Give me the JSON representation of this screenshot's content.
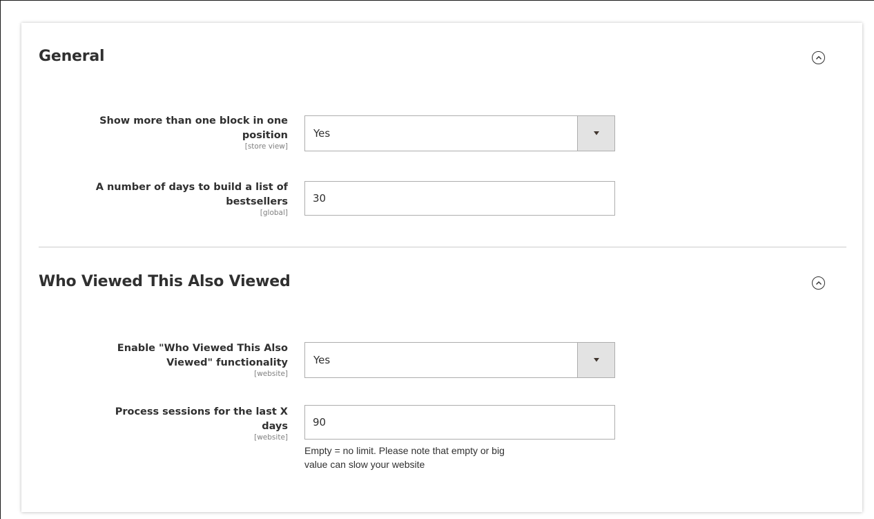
{
  "sections": [
    {
      "title": "General",
      "collapse_icon": "chevron-up-circle-icon",
      "fields": [
        {
          "label": "Show more than one block in one position",
          "label_line1": "Show more than one block in one",
          "label_line2": "position",
          "scope": "[store view]",
          "type": "select",
          "value": "Yes"
        },
        {
          "label": "A number of days to build a list of bestsellers",
          "label_line1": "A number of days to build a list of",
          "label_line2": "bestsellers",
          "scope": "[global]",
          "type": "text",
          "value": "30"
        }
      ]
    },
    {
      "title": "Who Viewed This Also Viewed",
      "collapse_icon": "chevron-up-circle-icon",
      "fields": [
        {
          "label": "Enable \"Who Viewed This Also Viewed\" functionality",
          "label_line1": "Enable \"Who Viewed This Also",
          "label_line2": "Viewed\" functionality",
          "scope": "[website]",
          "type": "select",
          "value": "Yes"
        },
        {
          "label": "Process sessions for the last X days",
          "label_line1": "Process sessions for the last X",
          "label_line2": "days",
          "scope": "[website]",
          "type": "text",
          "value": "90",
          "note_line1": "Empty = no limit. Please note that empty or big",
          "note_line2": "value can slow your website"
        }
      ]
    }
  ],
  "colors": {
    "text": "#303030",
    "scope_text": "#808080",
    "input_border": "#adadad",
    "select_button_bg": "#e3e3e3",
    "divider": "#cccccc"
  }
}
